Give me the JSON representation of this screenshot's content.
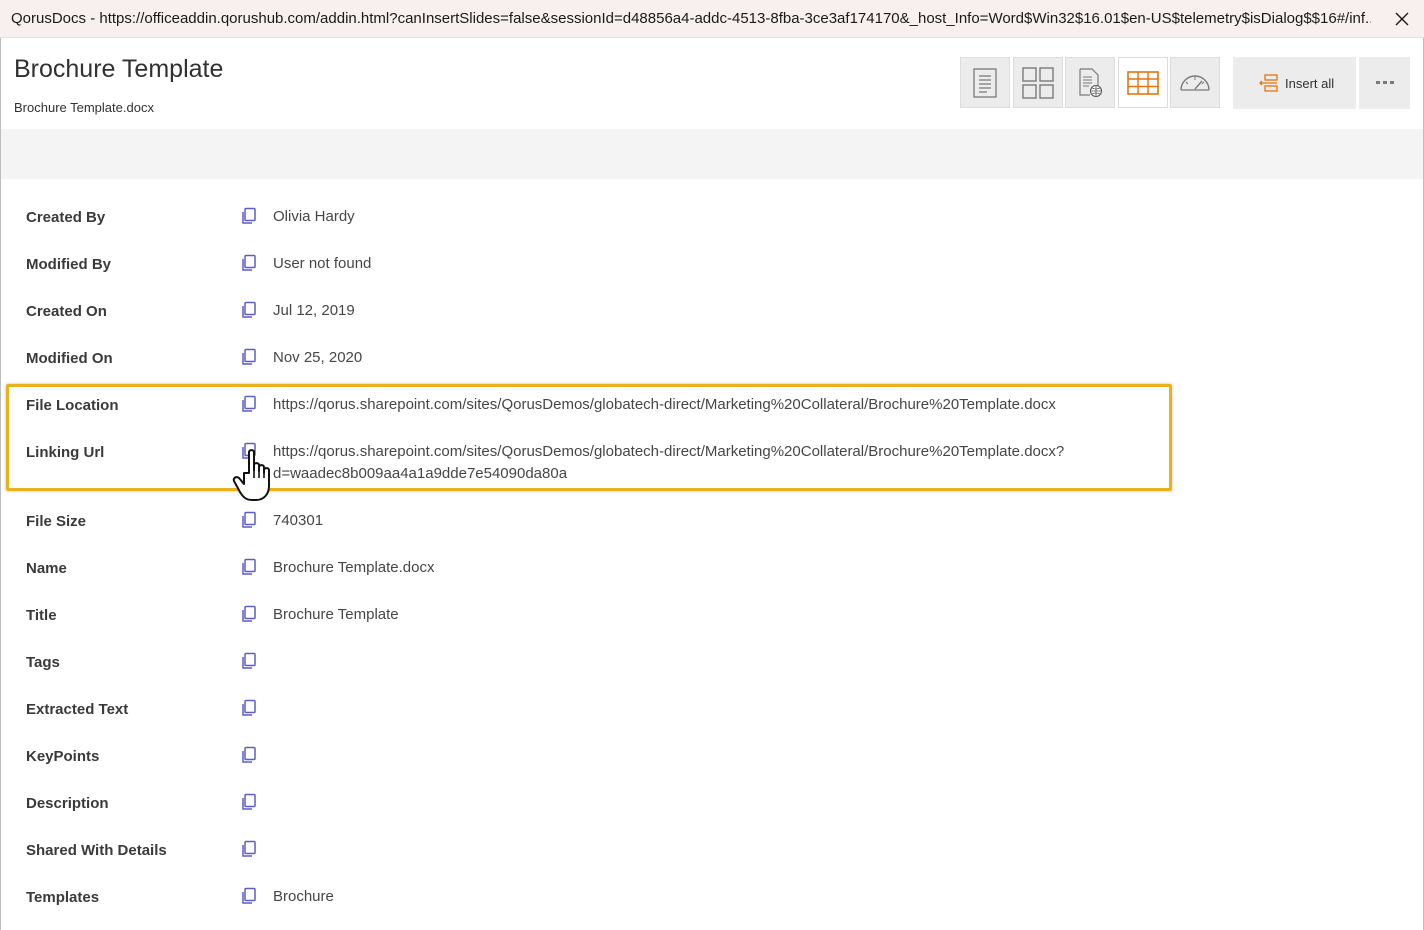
{
  "window": {
    "title": "QorusDocs - https://officeaddin.qorushub.com/addin.html?canInsertSlides=false&sessionId=d48856a4-addc-4513-8fba-3ce3af174170&_host_Info=Word$Win32$16.01$en-US$telemetry$isDialog$$16#/inf...",
    "close_icon": "close-icon"
  },
  "header": {
    "title": "Brochure Template",
    "filename": "Brochure Template.docx"
  },
  "toolbar": {
    "buttons": [
      {
        "name": "document-view-icon",
        "active": false
      },
      {
        "name": "grid-view-icon",
        "active": false
      },
      {
        "name": "web-document-icon",
        "active": false
      },
      {
        "name": "table-view-icon",
        "active": true
      },
      {
        "name": "gauge-icon",
        "active": false
      }
    ],
    "insert_all_label": "Insert all",
    "more_label": "···"
  },
  "accent": "#e8730c",
  "highlight_color": "#e8b21b",
  "copy_icon_color": "#5b5fc7",
  "properties": [
    {
      "label": "Created By",
      "value": "Olivia Hardy"
    },
    {
      "label": "Modified By",
      "value": "User not found"
    },
    {
      "label": "Created On",
      "value": "Jul 12, 2019"
    },
    {
      "label": "Modified On",
      "value": "Nov 25, 2020"
    },
    {
      "label": "File Location",
      "value": "https://qorus.sharepoint.com/sites/QorusDemos/globatech-direct/Marketing%20Collateral/Brochure%20Template.docx"
    },
    {
      "label": "Linking Url",
      "value": "https://qorus.sharepoint.com/sites/QorusDemos/globatech-direct/Marketing%20Collateral/Brochure%20Template.docx?",
      "value_line2": "d=waadec8b009aa4a1a9dde7e54090da80a"
    },
    {
      "label": "File Size",
      "value": "740301"
    },
    {
      "label": "Name",
      "value": "Brochure Template.docx"
    },
    {
      "label": "Title",
      "value": "Brochure Template"
    },
    {
      "label": "Tags",
      "value": ""
    },
    {
      "label": "Extracted Text",
      "value": ""
    },
    {
      "label": "KeyPoints",
      "value": ""
    },
    {
      "label": "Description",
      "value": ""
    },
    {
      "label": "Shared With Details",
      "value": ""
    },
    {
      "label": "Templates",
      "value": "Brochure"
    }
  ]
}
